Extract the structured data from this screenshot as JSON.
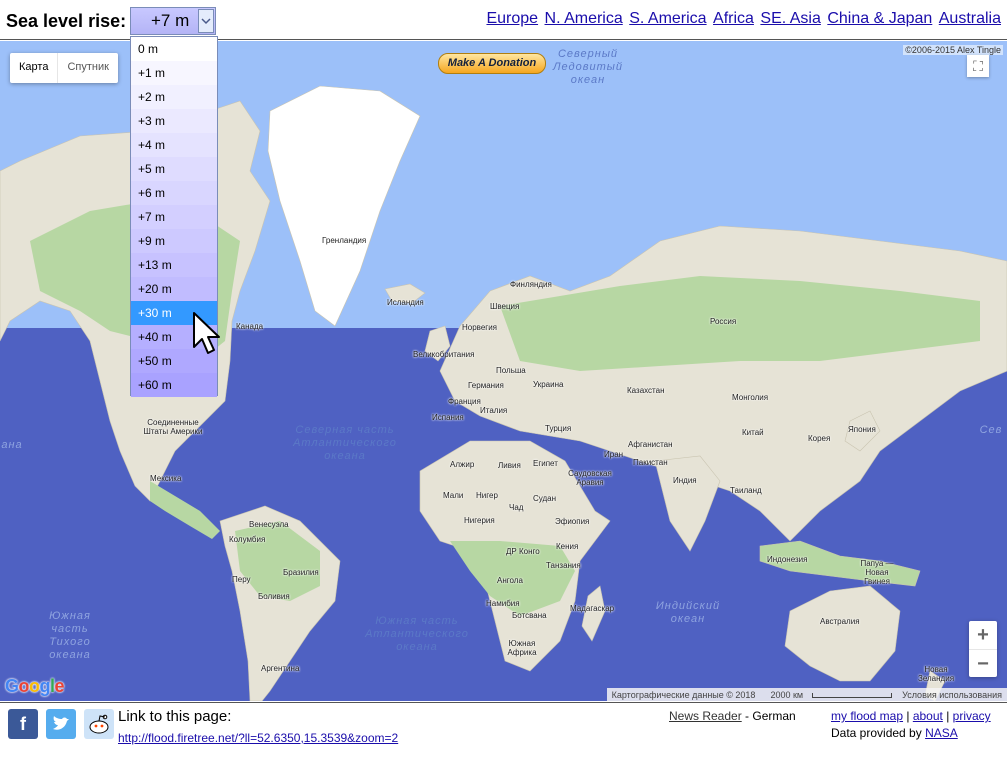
{
  "toolbar": {
    "label": "Sea level rise:",
    "selected_level": "+7 m",
    "regions": [
      "Europe",
      "N. America",
      "S. America",
      "Africa",
      "SE. Asia",
      "China & Japan",
      "Australia"
    ]
  },
  "dropdown": {
    "options": [
      "0 m",
      "+1 m",
      "+2 m",
      "+3 m",
      "+4 m",
      "+5 m",
      "+6 m",
      "+7 m",
      "+9 m",
      "+13 m",
      "+20 m",
      "+30 m",
      "+40 m",
      "+50 m",
      "+60 m"
    ],
    "highlighted": "+30 m"
  },
  "map": {
    "type_buttons": [
      "Карта",
      "Спутник"
    ],
    "donate_label": "Make A Donation",
    "copyright": "©2006-2015 Alex Tingle",
    "google_logo": "Google",
    "attribution": {
      "map_data": "Картографические данные © 2018",
      "scale": "2000 км",
      "terms": "Условия использования"
    },
    "zoom_in": "+",
    "zoom_out": "−",
    "fullscreen_icon": "⛶",
    "labels": {
      "greenland": "Гренландия",
      "iceland": "Исландия",
      "finland": "Финляндия",
      "sweden": "Швеция",
      "norway": "Норвегия",
      "russia": "Россия",
      "uk": "Великобритания",
      "poland": "Польша",
      "germany": "Германия",
      "ukraine": "Украина",
      "france": "Франция",
      "italy": "Италия",
      "spain": "Испания",
      "kazakhstan": "Казахстан",
      "mongolia": "Монголия",
      "turkey": "Турция",
      "afghanistan": "Афганистан",
      "china": "Китай",
      "korea": "Корея",
      "japan": "Япония",
      "iran": "Иран",
      "pakistan": "Пакистан",
      "egypt": "Египет",
      "saudi": "Саудовская Аравия",
      "india": "Индия",
      "thailand": "Таиланд",
      "algeria": "Алжир",
      "libya": "Ливия",
      "mali": "Мали",
      "niger": "Нигер",
      "chad": "Чад",
      "sudan": "Судан",
      "nigeria": "Нигерия",
      "ethiopia": "Эфиопия",
      "kenya": "Кения",
      "drc": "ДР Конго",
      "tanzania": "Танзания",
      "angola": "Ангола",
      "namibia": "Намибия",
      "botswana": "Ботсвана",
      "south_africa": "Южная Африка",
      "madagascar": "Мадагаскар",
      "indonesia": "Индонезия",
      "papua": "Папуа — Новая Гвинея",
      "australia": "Австралия",
      "new_zealand": "Новая Зеландия",
      "canada": "Канада",
      "usa": "Соединенные Штаты Америки",
      "mexico": "Мексика",
      "venezuela": "Венесуэла",
      "colombia": "Колумбия",
      "peru": "Перу",
      "brazil": "Бразилия",
      "bolivia": "Боливия",
      "argentina": "Аргентина"
    },
    "oceans": {
      "arctic": "Северный Ледовитый океан",
      "n_atlantic": "Северная часть Атлантического океана",
      "s_atlantic": "Южная часть Атлантического океана",
      "indian": "Индийский океан",
      "s_pacific": "Южная часть Тихого океана",
      "arctic_left": "океан",
      "pacific_left": "ана",
      "pacific_right": "Сев"
    }
  },
  "footer": {
    "share_icons": [
      "f",
      "t",
      "r"
    ],
    "link_label": "Link to this page:",
    "permalink": "http://flood.firetree.net/?ll=52.6350,15.3539&zoom=2",
    "news_reader": "News Reader",
    "news_lang": " - German",
    "links": [
      "my flood map",
      "about",
      "privacy"
    ],
    "provided_prefix": "Data provided by ",
    "provider": "NASA"
  },
  "colors": {
    "flood": "#4f61c2",
    "ocean": "#9cc0f9",
    "land": "#e6e3d6",
    "forest": "#b7d7a3",
    "ice": "#ffffff",
    "link": "#1a0dab"
  }
}
